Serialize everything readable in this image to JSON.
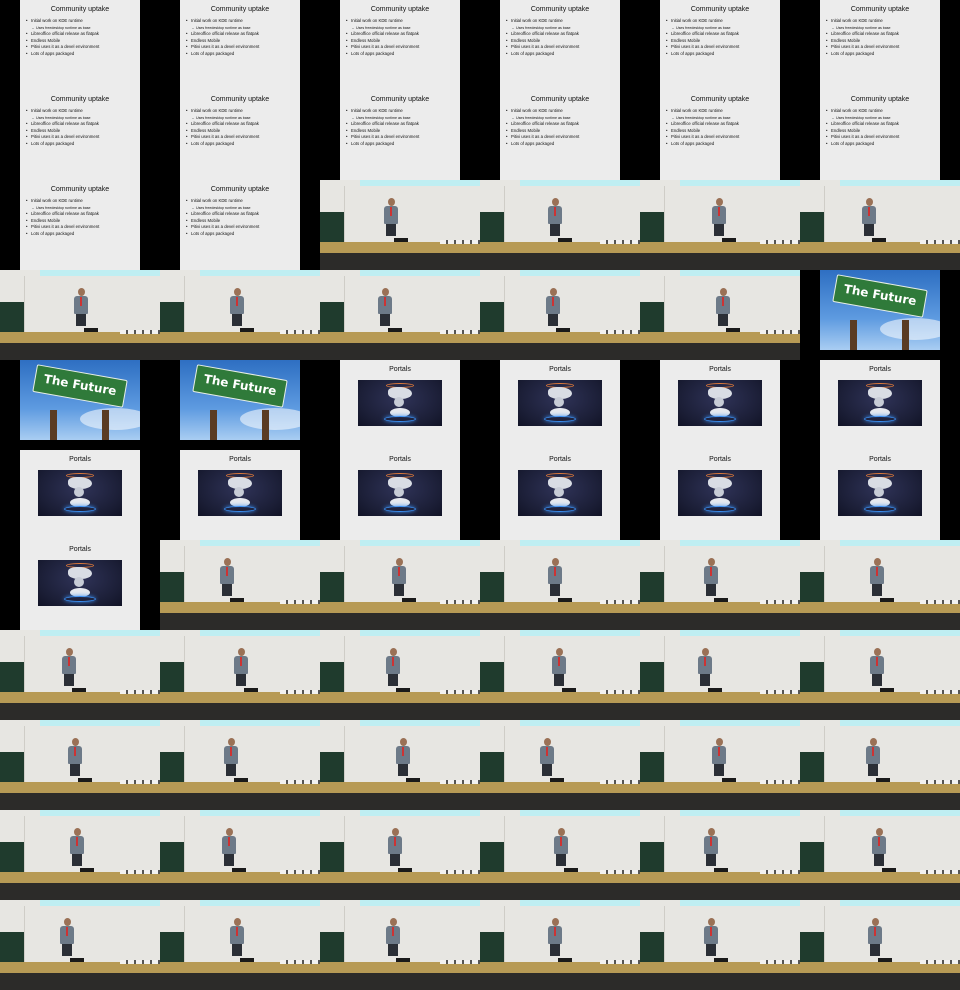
{
  "grid": {
    "columns": 6,
    "rows": 11
  },
  "slides": {
    "community": {
      "title": "Community uptake",
      "bullets": [
        {
          "text": "Initial work on KDE runtime",
          "sub": false
        },
        {
          "text": "Uses freedesktop runtime as base",
          "sub": true
        },
        {
          "text": "Libreoffice official release as flatpak",
          "sub": false
        },
        {
          "text": "Endless Mobile",
          "sub": false
        },
        {
          "text": "Pitivi uses it as a devel environment",
          "sub": false
        },
        {
          "text": "Lots of apps packaged",
          "sub": false
        }
      ]
    },
    "future": {
      "sign_text": "The Future"
    },
    "portals": {
      "title": "Portals"
    }
  },
  "frames": [
    "community",
    "community",
    "community",
    "community",
    "community",
    "community",
    "community",
    "community",
    "community",
    "community",
    "community",
    "community",
    "community",
    "community",
    "stage",
    "stage",
    "stage",
    "stage",
    "stage",
    "stage",
    "stage",
    "stage",
    "stage",
    "future",
    "future",
    "future",
    "portals",
    "portals",
    "portals",
    "portals",
    "portals",
    "portals",
    "portals",
    "portals",
    "portals",
    "portals",
    "portals",
    "stage",
    "stage",
    "stage",
    "stage",
    "stage",
    "stage",
    "stage",
    "stage",
    "stage",
    "stage",
    "stage",
    "stage",
    "stage",
    "stage",
    "stage",
    "stage",
    "stage",
    "stage",
    "stage",
    "stage",
    "stage",
    "stage",
    "stage",
    "stage",
    "stage",
    "stage",
    "stage",
    "stage",
    "stage"
  ],
  "colors": {
    "slide_bg": "#ececec",
    "stage_wall": "#e7e6e2",
    "stage_bar": "#bfeef2",
    "desk": "#b79a55",
    "sign_green": "#2f7a3a"
  }
}
